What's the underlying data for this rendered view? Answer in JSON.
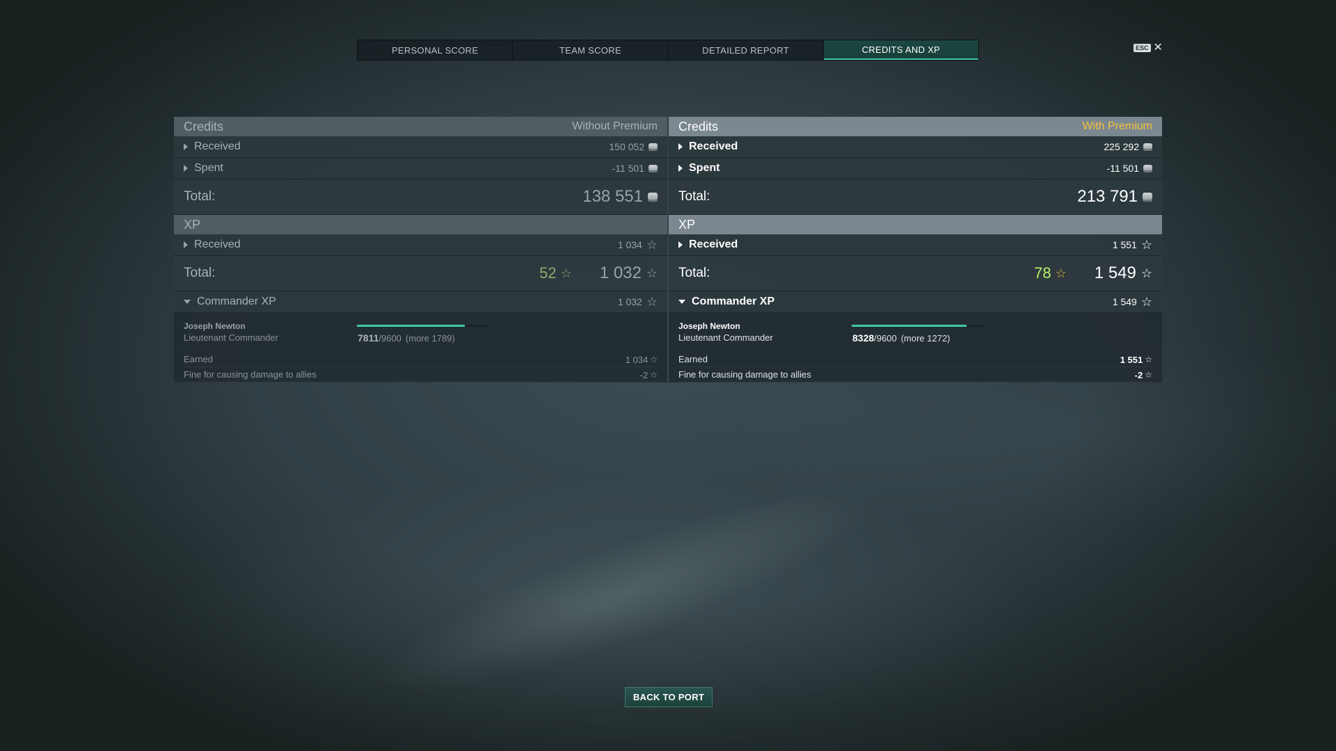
{
  "tabs": [
    {
      "label": "PERSONAL SCORE",
      "active": false
    },
    {
      "label": "TEAM SCORE",
      "active": false
    },
    {
      "label": "DETAILED REPORT",
      "active": false
    },
    {
      "label": "CREDITS AND XP",
      "active": true
    }
  ],
  "esc_label": "ESC",
  "close_glyph": "✕",
  "back_button_label": "BACK TO PORT",
  "colors": {
    "accent": "#3fc9a8",
    "premium": "#f4c23e",
    "free_xp": "#b9f16a"
  },
  "left": {
    "credits_header": "Credits",
    "mode_label": "Without Premium",
    "received_label": "Received",
    "received_value": "150 052",
    "spent_label": "Spent",
    "spent_value": "-11 501",
    "total_label": "Total:",
    "total_value": "138 551",
    "xp_header": "XP",
    "xp_received_label": "Received",
    "xp_received_value": "1 034",
    "xp_total_label": "Total:",
    "free_xp_value": "52",
    "xp_total_value": "1 032",
    "commander_xp_label": "Commander XP",
    "commander_xp_value": "1 032",
    "commander_name": "Joseph Newton",
    "commander_rank": "Lieutenant Commander",
    "xp_current": "7811",
    "xp_max": "/9600",
    "xp_more": "(more 1789)",
    "xp_progress": 0.8136,
    "earned_label": "Earned",
    "earned_value": "1 034",
    "fine_label": "Fine for causing damage to allies",
    "fine_value": "-2"
  },
  "right": {
    "credits_header": "Credits",
    "mode_label": "With Premium",
    "received_label": "Received",
    "received_value": "225 292",
    "spent_label": "Spent",
    "spent_value": "-11 501",
    "total_label": "Total:",
    "total_value": "213 791",
    "xp_header": "XP",
    "xp_received_label": "Received",
    "xp_received_value": "1 551",
    "xp_total_label": "Total:",
    "free_xp_value": "78",
    "xp_total_value": "1 549",
    "commander_xp_label": "Commander XP",
    "commander_xp_value": "1 549",
    "commander_name": "Joseph Newton",
    "commander_rank": "Lieutenant Commander",
    "xp_current": "8328",
    "xp_max": "/9600",
    "xp_more": "(more 1272)",
    "xp_progress": 0.8675,
    "earned_label": "Earned",
    "earned_value": "1 551",
    "fine_label": "Fine for causing damage to allies",
    "fine_value": "-2"
  }
}
